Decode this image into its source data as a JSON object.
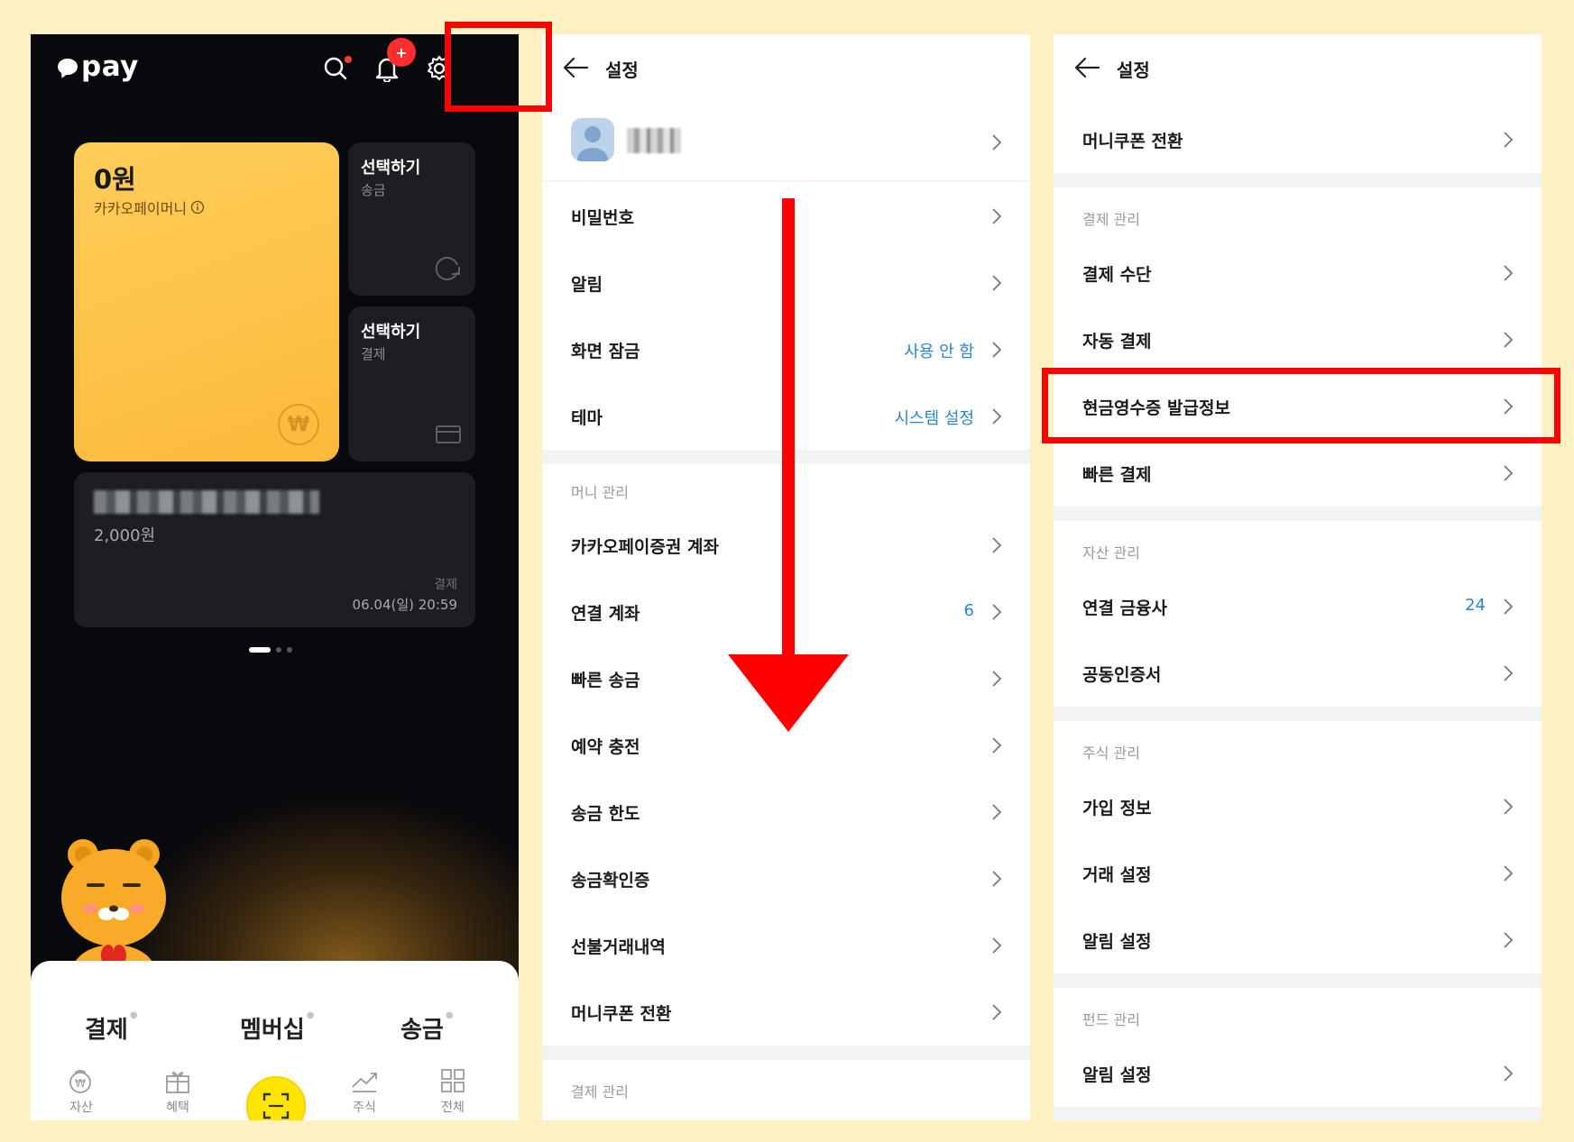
{
  "home": {
    "logo_text": "pay",
    "money_card": {
      "amount": "0원",
      "label": "카카오페이머니"
    },
    "send_card": {
      "title": "선택하기",
      "subtitle": "송금"
    },
    "pay_card": {
      "title": "선택하기",
      "subtitle": "결제"
    },
    "recent": {
      "amount": "2,000원",
      "type": "결제",
      "datetime": "06.04(일) 20:59"
    },
    "notification_badge": "+",
    "main_tabs": [
      "결제",
      "멤버십",
      "송금"
    ],
    "bottom_nav": [
      "자산",
      "혜택",
      "주식",
      "전체"
    ]
  },
  "settings_1": {
    "title": "설정",
    "rows": [
      {
        "label": "비밀번호",
        "value": ""
      },
      {
        "label": "알림",
        "value": ""
      },
      {
        "label": "화면 잠금",
        "value": "사용 안 함"
      },
      {
        "label": "테마",
        "value": "시스템 설정"
      }
    ],
    "section_money": "머니 관리",
    "money_rows": [
      {
        "label": "카카오페이증권 계좌",
        "value": ""
      },
      {
        "label": "연결 계좌",
        "value": "6"
      },
      {
        "label": "빠른 송금",
        "value": ""
      },
      {
        "label": "예약 충전",
        "value": ""
      },
      {
        "label": "송금 한도",
        "value": ""
      },
      {
        "label": "송금확인증",
        "value": ""
      },
      {
        "label": "선불거래내역",
        "value": ""
      },
      {
        "label": "머니쿠폰 전환",
        "value": ""
      }
    ],
    "section_payment": "결제 관리"
  },
  "settings_2": {
    "title": "설정",
    "top_row": "머니쿠폰 전환",
    "section_payment": "결제 관리",
    "payment_rows": [
      "결제 수단",
      "자동 결제",
      "현금영수증 발급정보",
      "빠른 결제"
    ],
    "section_assets": "자산 관리",
    "asset_rows": [
      {
        "label": "연결 금융사",
        "value": "24"
      },
      {
        "label": "공동인증서",
        "value": ""
      }
    ],
    "section_stock": "주식 관리",
    "stock_rows": [
      "가입 정보",
      "거래 설정",
      "알림 설정"
    ],
    "section_fund": "펀드 관리",
    "fund_rows": [
      "알림 설정"
    ]
  },
  "colors": {
    "highlight": "#ff0000",
    "kakao_yellow": "#ffe400",
    "link_blue": "#2a85c9"
  }
}
